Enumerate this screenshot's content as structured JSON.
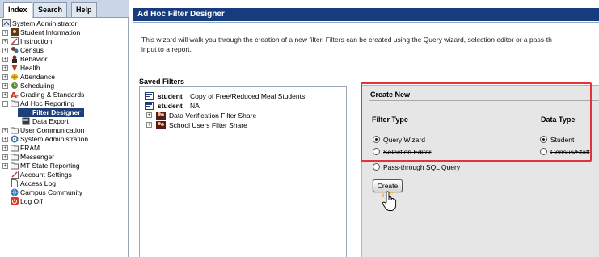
{
  "left_panel": {
    "tabs": [
      {
        "label": "Index",
        "active": true
      },
      {
        "label": "Search",
        "active": false
      },
      {
        "label": "Help",
        "active": false
      }
    ],
    "tree": [
      {
        "label": "System Administrator",
        "icon": "admin-icon"
      },
      {
        "label": "Student Information",
        "icon": "student-info-icon"
      },
      {
        "label": "Instruction",
        "icon": "instruction-icon"
      },
      {
        "label": "Census",
        "icon": "census-icon"
      },
      {
        "label": "Behavior",
        "icon": "behavior-icon"
      },
      {
        "label": "Health",
        "icon": "health-icon"
      },
      {
        "label": "Attendance",
        "icon": "attendance-icon"
      },
      {
        "label": "Scheduling",
        "icon": "scheduling-icon"
      },
      {
        "label": "Grading & Standards",
        "icon": "grading-icon"
      },
      {
        "label": "Ad Hoc Reporting",
        "icon": "folder-icon"
      },
      {
        "label": "Filter Designer",
        "icon": "filter-icon",
        "selected": true
      },
      {
        "label": "Data Export",
        "icon": "data-export-icon"
      },
      {
        "label": "User Communication",
        "icon": "folder-icon"
      },
      {
        "label": "System Administration",
        "icon": "system-admin-icon"
      },
      {
        "label": "FRAM",
        "icon": "folder-icon"
      },
      {
        "label": "Messenger",
        "icon": "folder-icon"
      },
      {
        "label": "MT State Reporting",
        "icon": "folder-icon"
      },
      {
        "label": "Account Settings",
        "icon": "account-settings-icon"
      },
      {
        "label": "Access Log",
        "icon": "access-log-icon"
      },
      {
        "label": "Campus Community",
        "icon": "campus-community-icon"
      },
      {
        "label": "Log Off",
        "icon": "log-off-icon"
      }
    ]
  },
  "main": {
    "title": "Ad Hoc Filter Designer",
    "intro_line1": "This wizard will walk you through the creation of a new filter. Filters can be created using the Query wizard, selection editor or a pass-th",
    "intro_line2": "input to a report.",
    "saved_filters": {
      "heading": "Saved Filters",
      "items": [
        {
          "prefix": "student",
          "name": "Copy of Free/Reduced Meal Students"
        },
        {
          "prefix": "student",
          "name": "NA"
        },
        {
          "prefix": "",
          "name": "Data Verification Filter Share"
        },
        {
          "prefix": "",
          "name": "School Users Filter Share"
        }
      ]
    },
    "create_new": {
      "heading": "Create New",
      "filter_type_heading": "Filter Type",
      "data_type_heading": "Data Type",
      "filter_types": [
        {
          "label": "Query Wizard",
          "checked": true
        },
        {
          "label": "Selection Editor",
          "checked": false
        },
        {
          "label": "Pass-through SQL Query",
          "checked": false
        }
      ],
      "data_types": [
        {
          "label": "Student",
          "checked": true
        },
        {
          "label": "Census/Staff",
          "checked": false
        }
      ],
      "create_button": "Create"
    }
  },
  "colors": {
    "title_bar": "#163c7e",
    "highlight": "#e3323a",
    "selected_node": "#1f3f7a"
  }
}
